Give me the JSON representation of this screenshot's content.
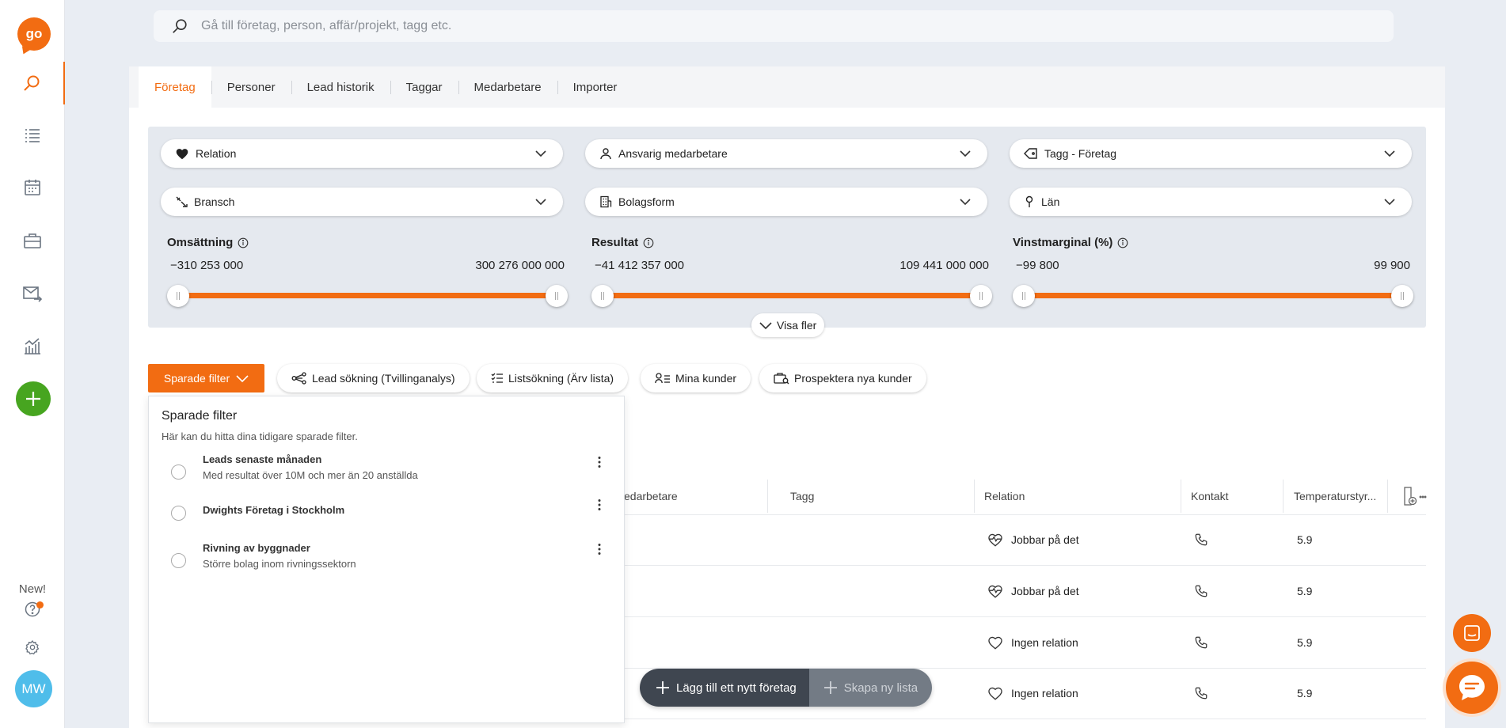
{
  "sidebar": {
    "logo": "go",
    "new_label": "New!",
    "avatar_initials": "MW",
    "accent_color": "#f26c12",
    "add_color": "#47a520"
  },
  "search": {
    "placeholder": "Gå till företag, person, affär/projekt, tagg etc."
  },
  "tabs": [
    "Företag",
    "Personer",
    "Lead historik",
    "Taggar",
    "Medarbetare",
    "Importer"
  ],
  "filters": {
    "dropdowns": {
      "relation": "Relation",
      "ansvarig": "Ansvarig medarbetare",
      "tagg": "Tagg - Företag",
      "bransch": "Bransch",
      "bolagsform": "Bolagsform",
      "lan": "Län"
    },
    "ranges": [
      {
        "title": "Omsättning",
        "min": "−310 253 000",
        "max": "300 276 000 000"
      },
      {
        "title": "Resultat",
        "min": "−41 412 357 000",
        "max": "109 441 000 000"
      },
      {
        "title": "Vinstmarginal (%)",
        "min": "−99 800",
        "max": "99 900"
      }
    ],
    "visa_fler": "Visa fler"
  },
  "actions": {
    "sparade": "Sparade filter",
    "lead": "Lead sökning (Tvillinganalys)",
    "lista": "Listsökning (Ärv lista)",
    "mina": "Mina kunder",
    "prospektera": "Prospektera nya kunder"
  },
  "saved_filters": {
    "title": "Sparade filter",
    "description": "Här kan du hitta dina tidigare sparade filter.",
    "items": [
      {
        "name": "Leads senaste månaden",
        "desc": "Med resultat över 10M och mer än 20 anställda"
      },
      {
        "name": "Dwights Företag i Stockholm",
        "desc": ""
      },
      {
        "name": "Rivning av byggnader",
        "desc": "Större bolag inom rivningssektorn"
      }
    ]
  },
  "table": {
    "headers": {
      "medarbetare": "edarbetare",
      "tagg": "Tagg",
      "relation": "Relation",
      "kontakt": "Kontakt",
      "temp": "Temperaturstyr..."
    },
    "rows": [
      {
        "relation": "Jobbar på det",
        "temp": "5.9"
      },
      {
        "relation": "Jobbar på det",
        "temp": "5.9"
      },
      {
        "relation": "Ingen relation",
        "temp": "5.9"
      },
      {
        "relation": "Ingen relation",
        "temp": "5.9"
      }
    ]
  },
  "bottom": {
    "add_company": "Lägg till ett nytt företag",
    "new_list": "Skapa ny lista"
  }
}
